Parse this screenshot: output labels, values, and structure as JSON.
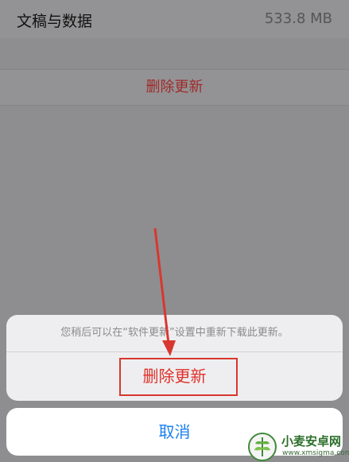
{
  "storage_row": {
    "label": "文稿与数据",
    "value": "533.8 MB"
  },
  "delete_update_row": {
    "label": "删除更新"
  },
  "action_sheet": {
    "message": "您稍后可以在“软件更新”设置中重新下载此更新。",
    "delete_label": "删除更新",
    "cancel_label": "取消"
  },
  "colors": {
    "destructive": "#e0302a",
    "accent": "#1a7ff0",
    "annotation": "#d8372f"
  },
  "icons": [
    "arrow-annotation-icon",
    "watermark-logo-icon"
  ],
  "watermark": {
    "title": "小麦安卓网",
    "url": "www.xmsigma.com"
  }
}
